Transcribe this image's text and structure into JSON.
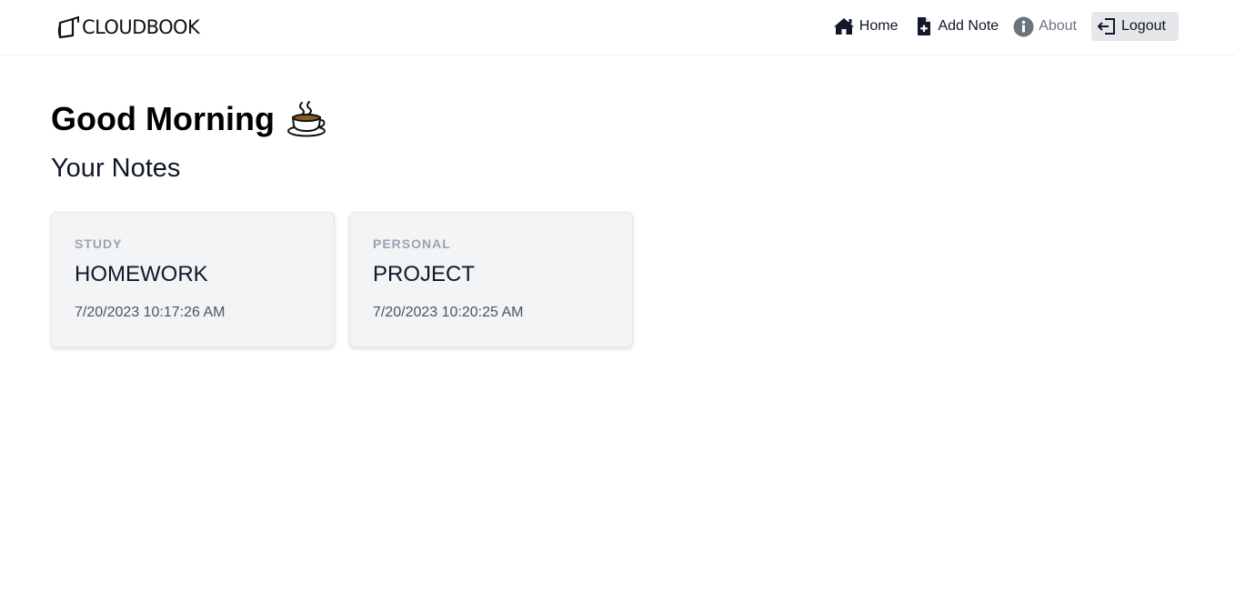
{
  "brand": {
    "name": "CLOUDBOOK",
    "icon": "cloudbook-logo-icon"
  },
  "nav": {
    "home": {
      "label": "Home",
      "icon": "home-icon"
    },
    "add_note": {
      "label": "Add Note",
      "icon": "file-plus-icon"
    },
    "about": {
      "label": "About",
      "icon": "info-circle-icon"
    },
    "logout": {
      "label": "Logout",
      "icon": "logout-icon"
    }
  },
  "main": {
    "greeting": "Good Morning",
    "greeting_icon": "coffee-cup-icon",
    "section_title": "Your Notes"
  },
  "notes": [
    {
      "category": "STUDY",
      "title": "HOMEWORK",
      "date": "7/20/2023 10:17:26 AM"
    },
    {
      "category": "PERSONAL",
      "title": "PROJECT",
      "date": "7/20/2023 10:20:25 AM"
    }
  ],
  "colors": {
    "card_background": "#f3f4f6",
    "logout_background": "#e5e7eb",
    "muted_text": "#6b7280"
  }
}
